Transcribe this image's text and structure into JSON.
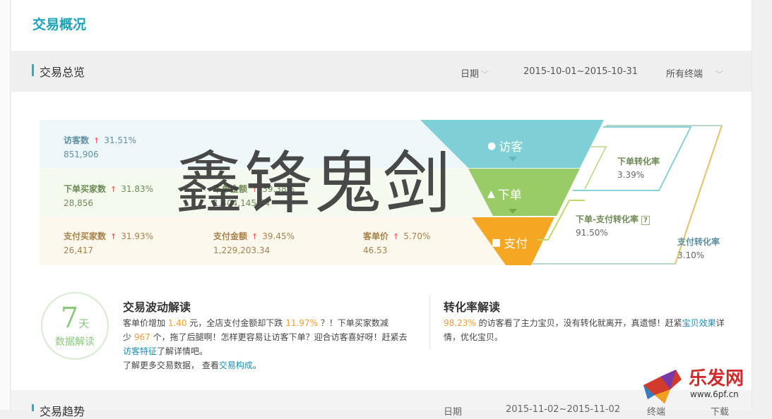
{
  "page": {
    "title": "交易概况"
  },
  "overview": {
    "title": "交易总览",
    "date_label": "日期",
    "date_range": "2015-10-01~2015-10-31",
    "terminal": "所有终端"
  },
  "rows": [
    {
      "metrics": [
        {
          "label": "访客数",
          "pct": "31.51%",
          "value": "851,906"
        }
      ]
    },
    {
      "metrics": [
        {
          "label": "下单买家数",
          "pct": "31.83%",
          "value": "28,856"
        },
        {
          "label": "下单金额",
          "pct": "39.38%",
          "value": "1,404,145.74"
        }
      ]
    },
    {
      "metrics": [
        {
          "label": "支付买家数",
          "pct": "31.93%",
          "value": "26,417"
        },
        {
          "label": "支付金额",
          "pct": "39.45%",
          "value": "1,229,203.34"
        },
        {
          "label": "客单价",
          "pct": "5.70%",
          "value": "46.53"
        }
      ]
    }
  ],
  "funnel": {
    "visitors": "访客",
    "order": "下单",
    "pay": "支付",
    "colors": {
      "visitors": "#7fd0d6",
      "order": "#99cc66",
      "pay": "#f5a623"
    }
  },
  "rates": {
    "order_rate": {
      "name": "下单转化率",
      "value": "3.39%"
    },
    "order_pay_rate": {
      "name": "下单-支付转化率",
      "value": "91.50%"
    },
    "pay_rate": {
      "name": "支付转化率",
      "value": "3.10%"
    }
  },
  "watermark": "鑫锋鬼剑",
  "badge": {
    "number": "7",
    "unit": "天",
    "caption": "数据解读"
  },
  "fluctuation": {
    "title": "交易波动解读",
    "line1_a": "客单价增加",
    "line1_b": "1.40",
    "line1_c": "元，全店支付金额却下跌",
    "line1_d": "11.97%",
    "line1_e": "？！下单买家数减",
    "line2_a": "少",
    "line2_b": "967",
    "line2_c": "个，拖了后腿啊！怎样更容易让访客下单？迎合访客喜好呀！赶紧去",
    "line3_link": "访客特征",
    "line3_b": "了解详情吧。",
    "line4_a": "了解更多交易数据，",
    "line4_b": "查看",
    "line4_link": "交易构成",
    "line4_c": "。"
  },
  "conversion": {
    "title": "转化率解读",
    "pct": "98.23%",
    "text_a": "的访客看了主力宝贝，没有转化就离开，真遗憾！赶紧",
    "link": "宝贝效果",
    "text_b": "详",
    "text_c": "情，优化宝贝。"
  },
  "trend": {
    "title": "交易趋势",
    "date_label": "日期",
    "date_range": "2015-11-02~2015-11-02",
    "ctl_a": "终端",
    "ctl_b": "下载"
  },
  "logo": {
    "name": "乐发网",
    "url": "www.6pf.cn"
  }
}
